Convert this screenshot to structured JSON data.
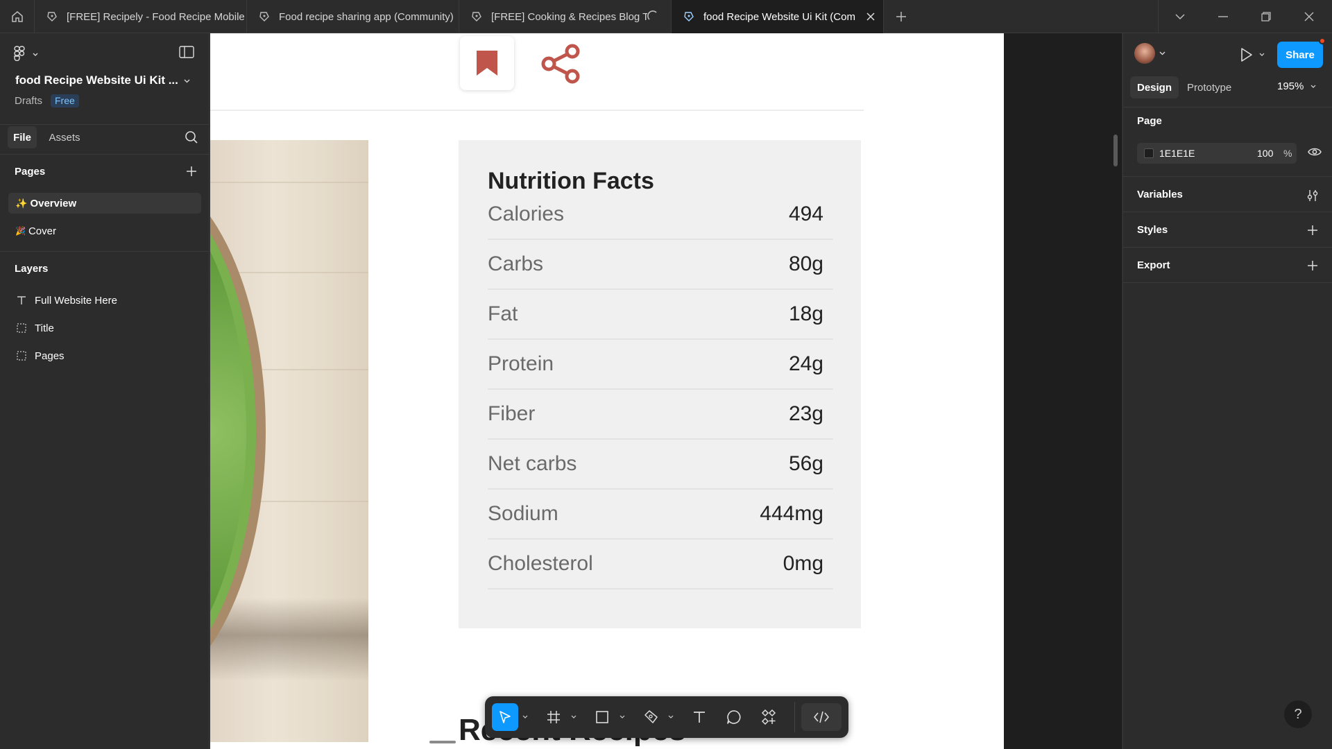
{
  "tabs": [
    {
      "label": "[FREE] Recipely - Food Recipe Mobile",
      "active": false
    },
    {
      "label": "Food recipe sharing app (Community)",
      "active": false
    },
    {
      "label": "[FREE] Cooking & Recipes Blog T",
      "active": false,
      "loading": true
    },
    {
      "label": "food Recipe Website Ui Kit (Com",
      "active": true
    }
  ],
  "left_panel": {
    "file_name": "food Recipe Website Ui Kit ...",
    "location": "Drafts",
    "plan_badge": "Free",
    "tab_file": "File",
    "tab_assets": "Assets",
    "pages_heading": "Pages",
    "pages": [
      {
        "emoji": "✨",
        "label": "Overview",
        "selected": true
      },
      {
        "emoji": "🎉",
        "label": "Cover",
        "selected": false
      }
    ],
    "layers_heading": "Layers",
    "layers": [
      {
        "icon": "text-icon",
        "label": "Full Website Here"
      },
      {
        "icon": "frame-dashed-icon",
        "label": "Title"
      },
      {
        "icon": "frame-dashed-icon",
        "label": "Pages"
      }
    ]
  },
  "canvas": {
    "nutrition": {
      "title": "Nutrition Facts",
      "rows": [
        {
          "label": "Calories",
          "value": "494"
        },
        {
          "label": "Carbs",
          "value": "80g"
        },
        {
          "label": "Fat",
          "value": "18g"
        },
        {
          "label": "Protein",
          "value": "24g"
        },
        {
          "label": "Fiber",
          "value": "23g"
        },
        {
          "label": "Net carbs",
          "value": "56g"
        },
        {
          "label": "Sodium",
          "value": "444mg"
        },
        {
          "label": "Cholesterol",
          "value": "0mg"
        }
      ]
    },
    "recent_heading": "Recent Recipes",
    "accent": "#c0564b"
  },
  "right_panel": {
    "share_label": "Share",
    "tab_design": "Design",
    "tab_prototype": "Prototype",
    "zoom": "195%",
    "page_heading": "Page",
    "page_color": "1E1E1E",
    "page_opacity": "100",
    "percent_sign": "%",
    "variables_label": "Variables",
    "styles_label": "Styles",
    "export_label": "Export",
    "help": "?"
  },
  "colors": {
    "accent_blue": "#0d99ff",
    "canvas_bg": "#1e1e1e",
    "panel_bg": "#2c2c2c"
  }
}
